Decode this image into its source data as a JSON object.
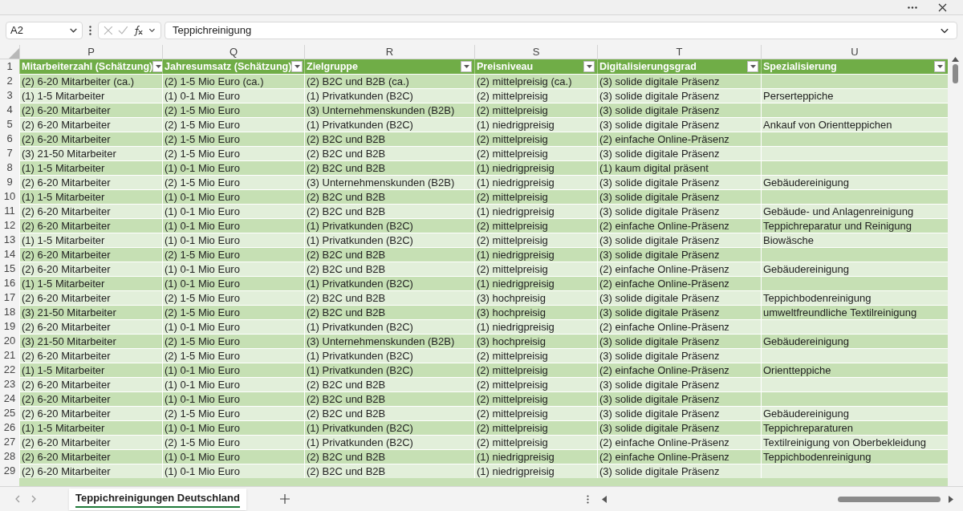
{
  "name_box": {
    "value": "A2"
  },
  "formula_bar": {
    "value": "Teppichreinigung"
  },
  "columns": [
    {
      "letter": "P",
      "header": "Mitarbeiterzahl (Schätzung)"
    },
    {
      "letter": "Q",
      "header": "Jahresumsatz (Schätzung)"
    },
    {
      "letter": "R",
      "header": "Zielgruppe"
    },
    {
      "letter": "S",
      "header": "Preisniveau"
    },
    {
      "letter": "T",
      "header": "Digitalisierungsgrad"
    },
    {
      "letter": "U",
      "header": "Spezialisierung"
    }
  ],
  "header_row_number": "1",
  "rows": [
    {
      "number": "2",
      "cells": [
        "(2) 6-20 Mitarbeiter (ca.)",
        "(2) 1-5 Mio Euro (ca.)",
        "(2) B2C und B2B (ca.)",
        "(2) mittelpreisig (ca.)",
        "(3) solide digitale Präsenz",
        null
      ]
    },
    {
      "number": "3",
      "cells": [
        "(1) 1-5 Mitarbeiter",
        "(1) 0-1 Mio Euro",
        "(1) Privatkunden (B2C)",
        "(2) mittelpreisig",
        "(3) solide digitale Präsenz",
        "Perserteppiche"
      ]
    },
    {
      "number": "4",
      "cells": [
        "(2) 6-20 Mitarbeiter",
        "(2) 1-5 Mio Euro",
        "(3) Unternehmenskunden (B2B)",
        "(2) mittelpreisig",
        "(3) solide digitale Präsenz",
        null
      ]
    },
    {
      "number": "5",
      "cells": [
        "(2) 6-20 Mitarbeiter",
        "(2) 1-5 Mio Euro",
        "(1) Privatkunden (B2C)",
        "(1) niedrigpreisig",
        "(3) solide digitale Präsenz",
        "Ankauf von Orientteppichen"
      ]
    },
    {
      "number": "6",
      "cells": [
        "(2) 6-20 Mitarbeiter",
        "(2) 1-5 Mio Euro",
        "(2) B2C und B2B",
        "(2) mittelpreisig",
        "(2) einfache Online-Präsenz",
        null
      ]
    },
    {
      "number": "7",
      "cells": [
        "(3) 21-50 Mitarbeiter",
        "(2) 1-5 Mio Euro",
        "(2) B2C und B2B",
        "(2) mittelpreisig",
        "(3) solide digitale Präsenz",
        null
      ]
    },
    {
      "number": "8",
      "cells": [
        "(1) 1-5 Mitarbeiter",
        "(1) 0-1 Mio Euro",
        "(2) B2C und B2B",
        "(1) niedrigpreisig",
        "(1) kaum digital präsent",
        null
      ]
    },
    {
      "number": "9",
      "cells": [
        "(2) 6-20 Mitarbeiter",
        "(2) 1-5 Mio Euro",
        "(3) Unternehmenskunden (B2B)",
        "(1) niedrigpreisig",
        "(3) solide digitale Präsenz",
        "Gebäudereinigung"
      ]
    },
    {
      "number": "10",
      "cells": [
        "(1) 1-5 Mitarbeiter",
        "(1) 0-1 Mio Euro",
        "(2) B2C und B2B",
        "(2) mittelpreisig",
        "(3) solide digitale Präsenz",
        null
      ]
    },
    {
      "number": "11",
      "cells": [
        "(2) 6-20 Mitarbeiter",
        "(1) 0-1 Mio Euro",
        "(2) B2C und B2B",
        "(1) niedrigpreisig",
        "(3) solide digitale Präsenz",
        "Gebäude- und Anlagenreinigung"
      ]
    },
    {
      "number": "12",
      "cells": [
        "(2) 6-20 Mitarbeiter",
        "(1) 0-1 Mio Euro",
        "(1) Privatkunden (B2C)",
        "(2) mittelpreisig",
        "(2) einfache Online-Präsenz",
        "Teppichreparatur und Reinigung"
      ]
    },
    {
      "number": "13",
      "cells": [
        "(1) 1-5 Mitarbeiter",
        "(1) 0-1 Mio Euro",
        "(1) Privatkunden (B2C)",
        "(2) mittelpreisig",
        "(3) solide digitale Präsenz",
        "Biowäsche"
      ]
    },
    {
      "number": "14",
      "cells": [
        "(2) 6-20 Mitarbeiter",
        "(2) 1-5 Mio Euro",
        "(2) B2C und B2B",
        "(1) niedrigpreisig",
        "(3) solide digitale Präsenz",
        null
      ]
    },
    {
      "number": "15",
      "cells": [
        "(2) 6-20 Mitarbeiter",
        "(1) 0-1 Mio Euro",
        "(2) B2C und B2B",
        "(2) mittelpreisig",
        "(2) einfache Online-Präsenz",
        "Gebäudereinigung"
      ]
    },
    {
      "number": "16",
      "cells": [
        "(1) 1-5 Mitarbeiter",
        "(1) 0-1 Mio Euro",
        "(1) Privatkunden (B2C)",
        "(1) niedrigpreisig",
        "(2) einfache Online-Präsenz",
        null
      ]
    },
    {
      "number": "17",
      "cells": [
        "(2) 6-20 Mitarbeiter",
        "(2) 1-5 Mio Euro",
        "(2) B2C und B2B",
        "(3) hochpreisig",
        "(3) solide digitale Präsenz",
        "Teppichbodenreinigung"
      ]
    },
    {
      "number": "18",
      "cells": [
        "(3) 21-50 Mitarbeiter",
        "(2) 1-5 Mio Euro",
        "(2) B2C und B2B",
        "(3) hochpreisig",
        "(3) solide digitale Präsenz",
        "umweltfreundliche Textilreinigung"
      ]
    },
    {
      "number": "19",
      "cells": [
        "(2) 6-20 Mitarbeiter",
        "(1) 0-1 Mio Euro",
        "(1) Privatkunden (B2C)",
        "(1) niedrigpreisig",
        "(2) einfache Online-Präsenz",
        null
      ]
    },
    {
      "number": "20",
      "cells": [
        "(3) 21-50 Mitarbeiter",
        "(2) 1-5 Mio Euro",
        "(3) Unternehmenskunden (B2B)",
        "(3) hochpreisig",
        "(3) solide digitale Präsenz",
        "Gebäudereinigung"
      ]
    },
    {
      "number": "21",
      "cells": [
        "(2) 6-20 Mitarbeiter",
        "(2) 1-5 Mio Euro",
        "(1) Privatkunden (B2C)",
        "(2) mittelpreisig",
        "(3) solide digitale Präsenz",
        null
      ]
    },
    {
      "number": "22",
      "cells": [
        "(1) 1-5 Mitarbeiter",
        "(1) 0-1 Mio Euro",
        "(1) Privatkunden (B2C)",
        "(2) mittelpreisig",
        "(2) einfache Online-Präsenz",
        "Orientteppiche"
      ]
    },
    {
      "number": "23",
      "cells": [
        "(2) 6-20 Mitarbeiter",
        "(1) 0-1 Mio Euro",
        "(2) B2C und B2B",
        "(2) mittelpreisig",
        "(3) solide digitale Präsenz",
        null
      ]
    },
    {
      "number": "24",
      "cells": [
        "(2) 6-20 Mitarbeiter",
        "(1) 0-1 Mio Euro",
        "(2) B2C und B2B",
        "(2) mittelpreisig",
        "(3) solide digitale Präsenz",
        null
      ]
    },
    {
      "number": "25",
      "cells": [
        "(2) 6-20 Mitarbeiter",
        "(2) 1-5 Mio Euro",
        "(2) B2C und B2B",
        "(2) mittelpreisig",
        "(3) solide digitale Präsenz",
        "Gebäudereinigung"
      ]
    },
    {
      "number": "26",
      "cells": [
        "(1) 1-5 Mitarbeiter",
        "(1) 0-1 Mio Euro",
        "(1) Privatkunden (B2C)",
        "(2) mittelpreisig",
        "(3) solide digitale Präsenz",
        "Teppichreparaturen"
      ]
    },
    {
      "number": "27",
      "cells": [
        "(2) 6-20 Mitarbeiter",
        "(2) 1-5 Mio Euro",
        "(1) Privatkunden (B2C)",
        "(2) mittelpreisig",
        "(2) einfache Online-Präsenz",
        "Textilreinigung von Oberbekleidung"
      ]
    },
    {
      "number": "28",
      "cells": [
        "(2) 6-20 Mitarbeiter",
        "(1) 0-1 Mio Euro",
        "(2) B2C und B2B",
        "(1) niedrigpreisig",
        "(2) einfache Online-Präsenz",
        "Teppichbodenreinigung"
      ]
    },
    {
      "number": "29",
      "cells": [
        "(2) 6-20 Mitarbeiter",
        "(1) 0-1 Mio Euro",
        "(2) B2C und B2B",
        "(1) niedrigpreisig",
        "(3) solide digitale Präsenz",
        null
      ]
    }
  ],
  "sheet_tabs": [
    {
      "label": "Teppichreinigungen Deutschland",
      "selected": true
    }
  ]
}
